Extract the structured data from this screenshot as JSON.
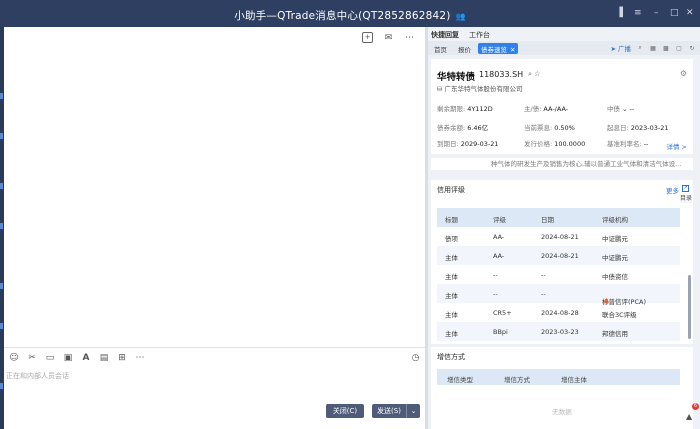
{
  "window": {
    "title": "小助手—QTrade消息中心(QT2852862842)"
  },
  "chat": {
    "input_placeholder": "正在和内部人员会话",
    "close_button": "关闭(C)",
    "send_button": "发送(S)"
  },
  "panel": {
    "tabs": [
      "快捷回复",
      "工作台"
    ],
    "subtabs": [
      "首页",
      "报价",
      "债券速览"
    ],
    "broadcast": "广播"
  },
  "bond": {
    "name": "华特转债",
    "code": "118033.SH",
    "issuer": "广东华特气体股份有限公司",
    "fields": [
      {
        "k": "剩余期限:",
        "v": "4Y112D"
      },
      {
        "k": "主/债:",
        "v": "AA-/AA-"
      },
      {
        "k": "中债",
        "v": "--"
      },
      {
        "k": "债券余额:",
        "v": "6.46亿"
      },
      {
        "k": "当前票息:",
        "v": "0.50%"
      },
      {
        "k": "起息日:",
        "v": "2023-03-21"
      },
      {
        "k": "到期日:",
        "v": "2029-03-21"
      },
      {
        "k": "发行价格:",
        "v": "100.0000"
      },
      {
        "k": "基准利率名:",
        "v": "--"
      }
    ],
    "detail_link": "详情 >",
    "snippet": "种气体的研发生产及销售为核心,辅以普通工业气体和清洁气体设..."
  },
  "credit": {
    "title": "信用评级",
    "more": "更多",
    "side_label": "目录",
    "columns": [
      "标题",
      "评级",
      "日期",
      "评级机构"
    ],
    "rows": [
      [
        "债项",
        "AA-",
        "2024-08-21",
        "中证鹏元"
      ],
      [
        "主体",
        "AA-",
        "2024-08-21",
        "中证鹏元"
      ],
      [
        "主体",
        "--",
        "--",
        "中债资信"
      ],
      [
        "主体",
        "--",
        "--",
        "标普信评(PCA)"
      ],
      [
        "主体",
        "CR5+",
        "2024-08-28",
        "联合3C评级"
      ],
      [
        "主体",
        "BBpi",
        "2023-03-23",
        "邦德信用"
      ]
    ]
  },
  "enhance": {
    "title": "增信方式",
    "columns": [
      "增信类型",
      "增信方式",
      "增信主体"
    ],
    "empty": "无数据"
  },
  "notification": {
    "badge": "6"
  }
}
